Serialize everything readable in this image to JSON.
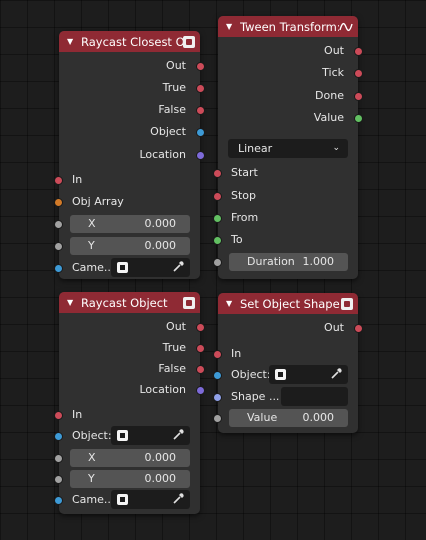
{
  "nodes": {
    "raycast_closest": {
      "title": "Raycast Closest O...",
      "outputs": [
        "Out",
        "True",
        "False",
        "Object",
        "Location"
      ],
      "inputs": {
        "in": "In",
        "obj_array": "Obj Array",
        "x_label": "X",
        "x_value": "0.000",
        "y_label": "Y",
        "y_value": "0.000",
        "camera": "Came..."
      }
    },
    "tween_transform": {
      "title": "Tween Transform:",
      "outputs": [
        "Out",
        "Tick",
        "Done",
        "Value"
      ],
      "mode": "Linear",
      "inputs": {
        "start": "Start",
        "stop": "Stop",
        "from": "From",
        "to": "To",
        "duration_label": "Duration",
        "duration_value": "1.000"
      }
    },
    "raycast_object": {
      "title": "Raycast Object",
      "outputs": [
        "Out",
        "True",
        "False",
        "Location"
      ],
      "inputs": {
        "in": "In",
        "object": "Object:",
        "x_label": "X",
        "x_value": "0.000",
        "y_label": "Y",
        "y_value": "0.000",
        "camera": "Came..."
      }
    },
    "set_object_shape": {
      "title": "Set Object Shape ...",
      "outputs": [
        "Out"
      ],
      "inputs": {
        "in": "In",
        "object": "Object:",
        "shape": "Shape ...",
        "value_label": "Value",
        "value_value": "0.000"
      }
    }
  },
  "colors": {
    "header": "#8f2a34",
    "socket_red": "#cc4b59",
    "socket_blue": "#3d9ad6",
    "socket_purple": "#7d6ad8",
    "socket_orange": "#d27a28",
    "socket_gray": "#a1a1a1",
    "socket_green": "#62c062"
  }
}
